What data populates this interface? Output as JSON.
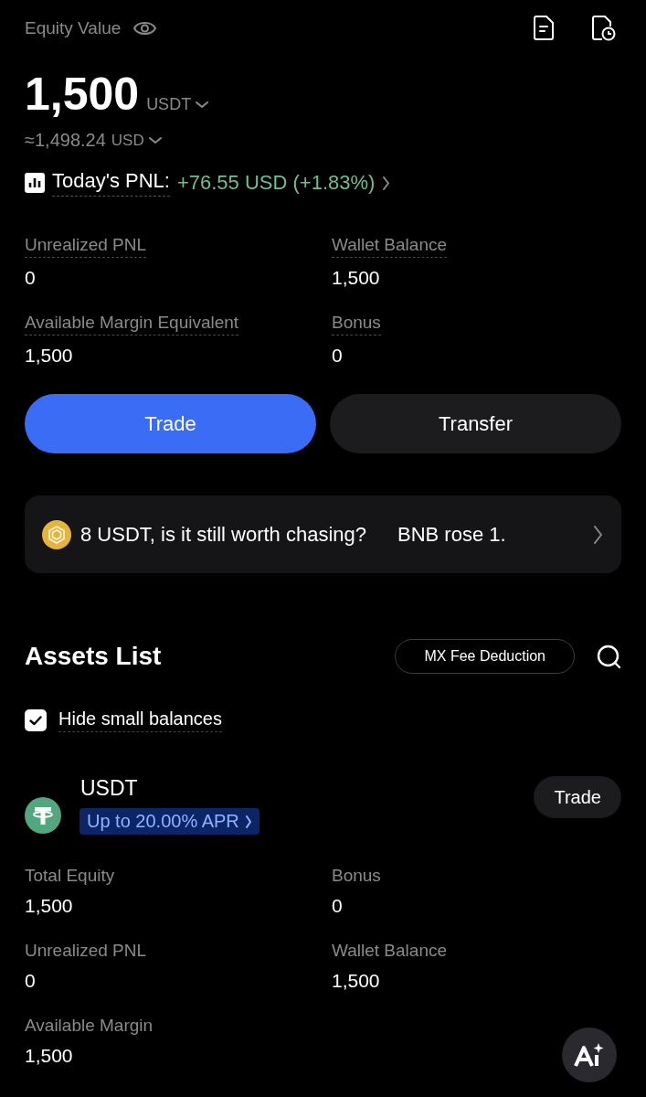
{
  "header": {
    "title": "Equity Value",
    "equity": "1,500",
    "equity_unit": "USDT",
    "approx": "≈1,498.24",
    "approx_unit": "USD"
  },
  "pnl": {
    "label": "Today's PNL:",
    "value": "+76.55 USD (+1.83%)"
  },
  "summary": [
    {
      "label": "Unrealized PNL",
      "value": "0"
    },
    {
      "label": "Wallet Balance",
      "value": "1,500"
    },
    {
      "label": "Available Margin Equivalent",
      "value": "1,500"
    },
    {
      "label": "Bonus",
      "value": "0"
    }
  ],
  "actions": [
    {
      "label": "Trade",
      "kind": "primary"
    },
    {
      "label": "Transfer",
      "kind": "secondary"
    }
  ],
  "ticker": [
    "8 USDT, is it still worth chasing?",
    "BNB rose 1."
  ],
  "assets_list": {
    "title": "Assets List",
    "fee_button": "MX Fee Deduction",
    "hide_small": {
      "label": "Hide small balances",
      "checked": true
    }
  },
  "assets": [
    {
      "symbol": "USDT",
      "promo": "Up to 20.00% APR",
      "trade": "Trade",
      "stats": [
        {
          "label": "Total Equity",
          "value": "1,500"
        },
        {
          "label": "Bonus",
          "value": "0"
        },
        {
          "label": "Unrealized PNL",
          "value": "0"
        },
        {
          "label": "Wallet Balance",
          "value": "1,500"
        },
        {
          "label": "Available Margin",
          "value": "1,500"
        }
      ]
    }
  ]
}
